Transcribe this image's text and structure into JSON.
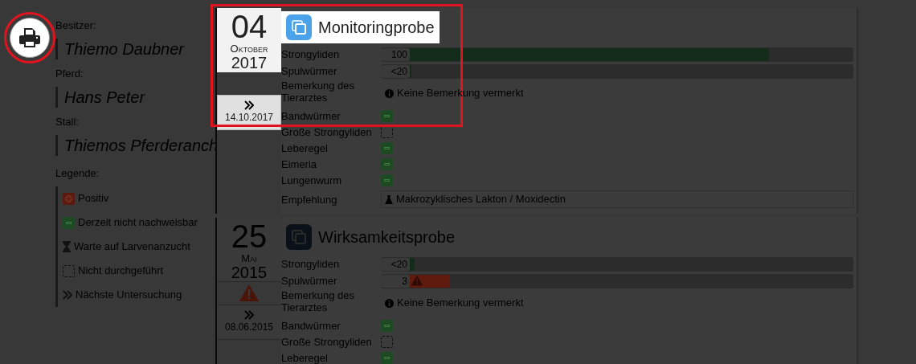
{
  "print_button": {
    "highlighted": true
  },
  "info": [
    {
      "label": "Besitzer:",
      "value": "Thiemo Daubner"
    },
    {
      "label": "Pferd:",
      "value": "Hans Peter"
    },
    {
      "label": "Stall:",
      "value": "Thiemos Pferderanch"
    }
  ],
  "legend": {
    "label": "Legende:",
    "items": [
      {
        "kind": "positive",
        "text": "Positiv"
      },
      {
        "kind": "negative",
        "text": "Derzeit nicht nachweisbar"
      },
      {
        "kind": "waiting",
        "text": "Warte auf Larvenanzucht"
      },
      {
        "kind": "not_done",
        "text": "Nicht durchgeführt"
      },
      {
        "kind": "next",
        "text": "Nächste Untersuchung"
      }
    ]
  },
  "entries": [
    {
      "highlighted": true,
      "day": "04",
      "month": "Oktober",
      "year": "2017",
      "warning": false,
      "next_date": "14.10.2017",
      "title": "Monitoringprobe",
      "rows": [
        {
          "kind": "bar",
          "label": "Strongyliden",
          "value": "100",
          "level": 0.81,
          "alert": false
        },
        {
          "kind": "bar",
          "label": "Spulwürmer",
          "value": "<20",
          "level": 0,
          "alert": false
        },
        {
          "kind": "note",
          "label": "Bemerkung des Tierarztes",
          "text": "Keine Bemerkung vermerkt"
        },
        {
          "kind": "negative",
          "label": "Bandwürmer"
        },
        {
          "kind": "not_done",
          "label": "Große Strongyliden"
        },
        {
          "kind": "negative",
          "label": "Leberegel"
        },
        {
          "kind": "negative",
          "label": "Eimeria"
        },
        {
          "kind": "negative",
          "label": "Lungenwurm"
        },
        {
          "kind": "recommendation",
          "label": "Empfehlung",
          "text": "Makrozyklisches Lakton / Moxidectin"
        }
      ]
    },
    {
      "highlighted": false,
      "day": "25",
      "month": "Mai",
      "year": "2015",
      "warning": true,
      "next_date": "08.06.2015",
      "title": "Wirksamkeitsprobe",
      "rows": [
        {
          "kind": "bar",
          "label": "Strongyliden",
          "value": "<20",
          "level": 0.01,
          "alert": false
        },
        {
          "kind": "bar",
          "label": "Spulwürmer",
          "value": "3",
          "level": 0.09,
          "alert": true
        },
        {
          "kind": "note",
          "label": "Bemerkung des Tierarztes",
          "text": "Keine Bemerkung vermerkt"
        },
        {
          "kind": "negative",
          "label": "Bandwürmer"
        },
        {
          "kind": "not_done",
          "label": "Große Strongyliden"
        },
        {
          "kind": "negative",
          "label": "Leberegel"
        }
      ]
    }
  ]
}
